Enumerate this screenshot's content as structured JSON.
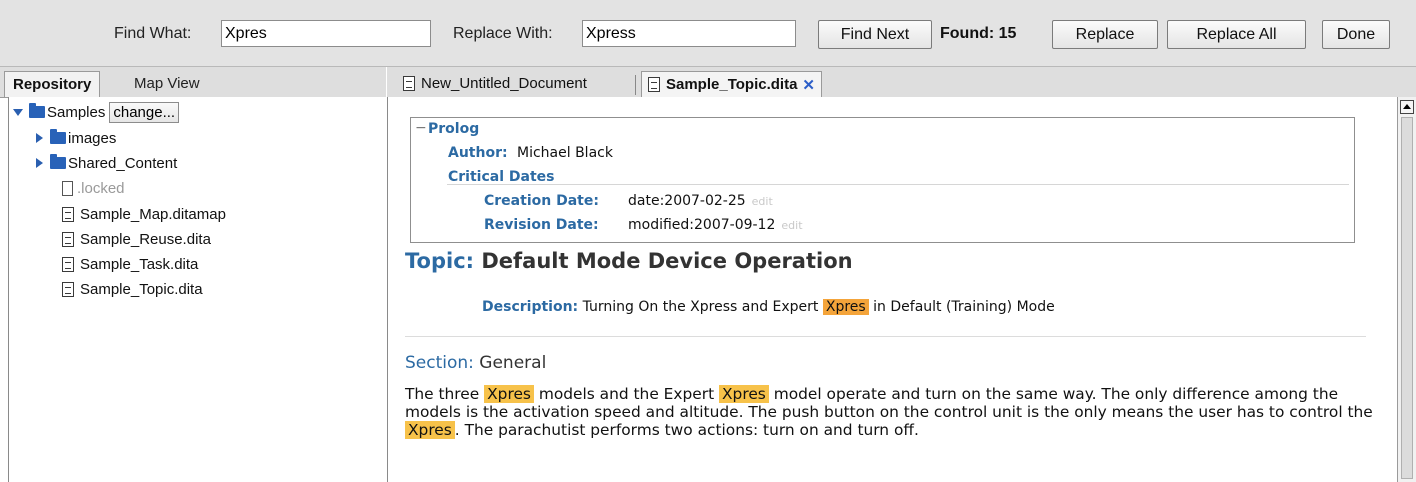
{
  "toolbar": {
    "find_label": "Find What:",
    "find_value": "Xpres",
    "replace_label": "Replace With:",
    "replace_value": "Xpress",
    "find_next_label": "Find Next",
    "found_text": "Found: 15",
    "replace_button": "Replace",
    "replace_all_button": "Replace All",
    "done_button": "Done"
  },
  "left": {
    "tabs": [
      "Repository",
      "Map View"
    ],
    "tree": {
      "root_label": "Samples",
      "change_label": "change...",
      "folders": [
        "images",
        "Shared_Content"
      ],
      "locked_label": ".locked",
      "files": [
        "Sample_Map.ditamap",
        "Sample_Reuse.dita",
        "Sample_Task.dita",
        "Sample_Topic.dita"
      ]
    }
  },
  "editor": {
    "tabs": [
      "New_Untitled_Document",
      "Sample_Topic.dita"
    ],
    "close_glyph": "✕",
    "prolog": {
      "header": "Prolog",
      "collapse_glyph": "−",
      "author_label": "Author:",
      "author_value": "Michael Black",
      "critical_dates_label": "Critical Dates",
      "creation_label": "Creation Date:",
      "creation_value": "date:2007-02-25",
      "revision_label": "Revision Date:",
      "revision_value": "modified:2007-09-12",
      "edit_link": "edit"
    },
    "topic_label": "Topic:",
    "topic_title": "Default Mode Device Operation",
    "description_label": "Description:",
    "description_before": "Turning On the Xpress and Expert",
    "description_match": "Xpres",
    "description_after": "in Default (Training) Mode",
    "section_label": "Section:",
    "section_title": "General",
    "paragraph": {
      "p1": "The three",
      "m1": "Xpres",
      "p2": "models and the Expert",
      "m2": "Xpres",
      "p3": "model operate and turn on the same way. The only difference among the models is the activation speed and altitude. The push button on the control unit is the only means the user has to control the",
      "m3": "Xpres",
      "p4": ". The parachutist performs two actions: turn on and turn off."
    }
  },
  "colors": {
    "current_match": "#f4a43a",
    "match": "#f7c24a",
    "label_blue": "#2c6aa3",
    "close_blue": "#2c5ec8"
  }
}
